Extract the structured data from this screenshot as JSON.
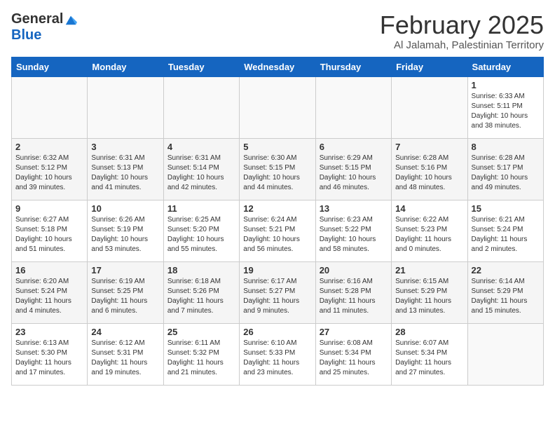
{
  "logo": {
    "general": "General",
    "blue": "Blue"
  },
  "title": "February 2025",
  "location": "Al Jalamah, Palestinian Territory",
  "weekdays": [
    "Sunday",
    "Monday",
    "Tuesday",
    "Wednesday",
    "Thursday",
    "Friday",
    "Saturday"
  ],
  "weeks": [
    [
      {
        "day": "",
        "info": ""
      },
      {
        "day": "",
        "info": ""
      },
      {
        "day": "",
        "info": ""
      },
      {
        "day": "",
        "info": ""
      },
      {
        "day": "",
        "info": ""
      },
      {
        "day": "",
        "info": ""
      },
      {
        "day": "1",
        "info": "Sunrise: 6:33 AM\nSunset: 5:11 PM\nDaylight: 10 hours and 38 minutes."
      }
    ],
    [
      {
        "day": "2",
        "info": "Sunrise: 6:32 AM\nSunset: 5:12 PM\nDaylight: 10 hours and 39 minutes."
      },
      {
        "day": "3",
        "info": "Sunrise: 6:31 AM\nSunset: 5:13 PM\nDaylight: 10 hours and 41 minutes."
      },
      {
        "day": "4",
        "info": "Sunrise: 6:31 AM\nSunset: 5:14 PM\nDaylight: 10 hours and 42 minutes."
      },
      {
        "day": "5",
        "info": "Sunrise: 6:30 AM\nSunset: 5:15 PM\nDaylight: 10 hours and 44 minutes."
      },
      {
        "day": "6",
        "info": "Sunrise: 6:29 AM\nSunset: 5:15 PM\nDaylight: 10 hours and 46 minutes."
      },
      {
        "day": "7",
        "info": "Sunrise: 6:28 AM\nSunset: 5:16 PM\nDaylight: 10 hours and 48 minutes."
      },
      {
        "day": "8",
        "info": "Sunrise: 6:28 AM\nSunset: 5:17 PM\nDaylight: 10 hours and 49 minutes."
      }
    ],
    [
      {
        "day": "9",
        "info": "Sunrise: 6:27 AM\nSunset: 5:18 PM\nDaylight: 10 hours and 51 minutes."
      },
      {
        "day": "10",
        "info": "Sunrise: 6:26 AM\nSunset: 5:19 PM\nDaylight: 10 hours and 53 minutes."
      },
      {
        "day": "11",
        "info": "Sunrise: 6:25 AM\nSunset: 5:20 PM\nDaylight: 10 hours and 55 minutes."
      },
      {
        "day": "12",
        "info": "Sunrise: 6:24 AM\nSunset: 5:21 PM\nDaylight: 10 hours and 56 minutes."
      },
      {
        "day": "13",
        "info": "Sunrise: 6:23 AM\nSunset: 5:22 PM\nDaylight: 10 hours and 58 minutes."
      },
      {
        "day": "14",
        "info": "Sunrise: 6:22 AM\nSunset: 5:23 PM\nDaylight: 11 hours and 0 minutes."
      },
      {
        "day": "15",
        "info": "Sunrise: 6:21 AM\nSunset: 5:24 PM\nDaylight: 11 hours and 2 minutes."
      }
    ],
    [
      {
        "day": "16",
        "info": "Sunrise: 6:20 AM\nSunset: 5:24 PM\nDaylight: 11 hours and 4 minutes."
      },
      {
        "day": "17",
        "info": "Sunrise: 6:19 AM\nSunset: 5:25 PM\nDaylight: 11 hours and 6 minutes."
      },
      {
        "day": "18",
        "info": "Sunrise: 6:18 AM\nSunset: 5:26 PM\nDaylight: 11 hours and 7 minutes."
      },
      {
        "day": "19",
        "info": "Sunrise: 6:17 AM\nSunset: 5:27 PM\nDaylight: 11 hours and 9 minutes."
      },
      {
        "day": "20",
        "info": "Sunrise: 6:16 AM\nSunset: 5:28 PM\nDaylight: 11 hours and 11 minutes."
      },
      {
        "day": "21",
        "info": "Sunrise: 6:15 AM\nSunset: 5:29 PM\nDaylight: 11 hours and 13 minutes."
      },
      {
        "day": "22",
        "info": "Sunrise: 6:14 AM\nSunset: 5:29 PM\nDaylight: 11 hours and 15 minutes."
      }
    ],
    [
      {
        "day": "23",
        "info": "Sunrise: 6:13 AM\nSunset: 5:30 PM\nDaylight: 11 hours and 17 minutes."
      },
      {
        "day": "24",
        "info": "Sunrise: 6:12 AM\nSunset: 5:31 PM\nDaylight: 11 hours and 19 minutes."
      },
      {
        "day": "25",
        "info": "Sunrise: 6:11 AM\nSunset: 5:32 PM\nDaylight: 11 hours and 21 minutes."
      },
      {
        "day": "26",
        "info": "Sunrise: 6:10 AM\nSunset: 5:33 PM\nDaylight: 11 hours and 23 minutes."
      },
      {
        "day": "27",
        "info": "Sunrise: 6:08 AM\nSunset: 5:34 PM\nDaylight: 11 hours and 25 minutes."
      },
      {
        "day": "28",
        "info": "Sunrise: 6:07 AM\nSunset: 5:34 PM\nDaylight: 11 hours and 27 minutes."
      },
      {
        "day": "",
        "info": ""
      }
    ]
  ]
}
